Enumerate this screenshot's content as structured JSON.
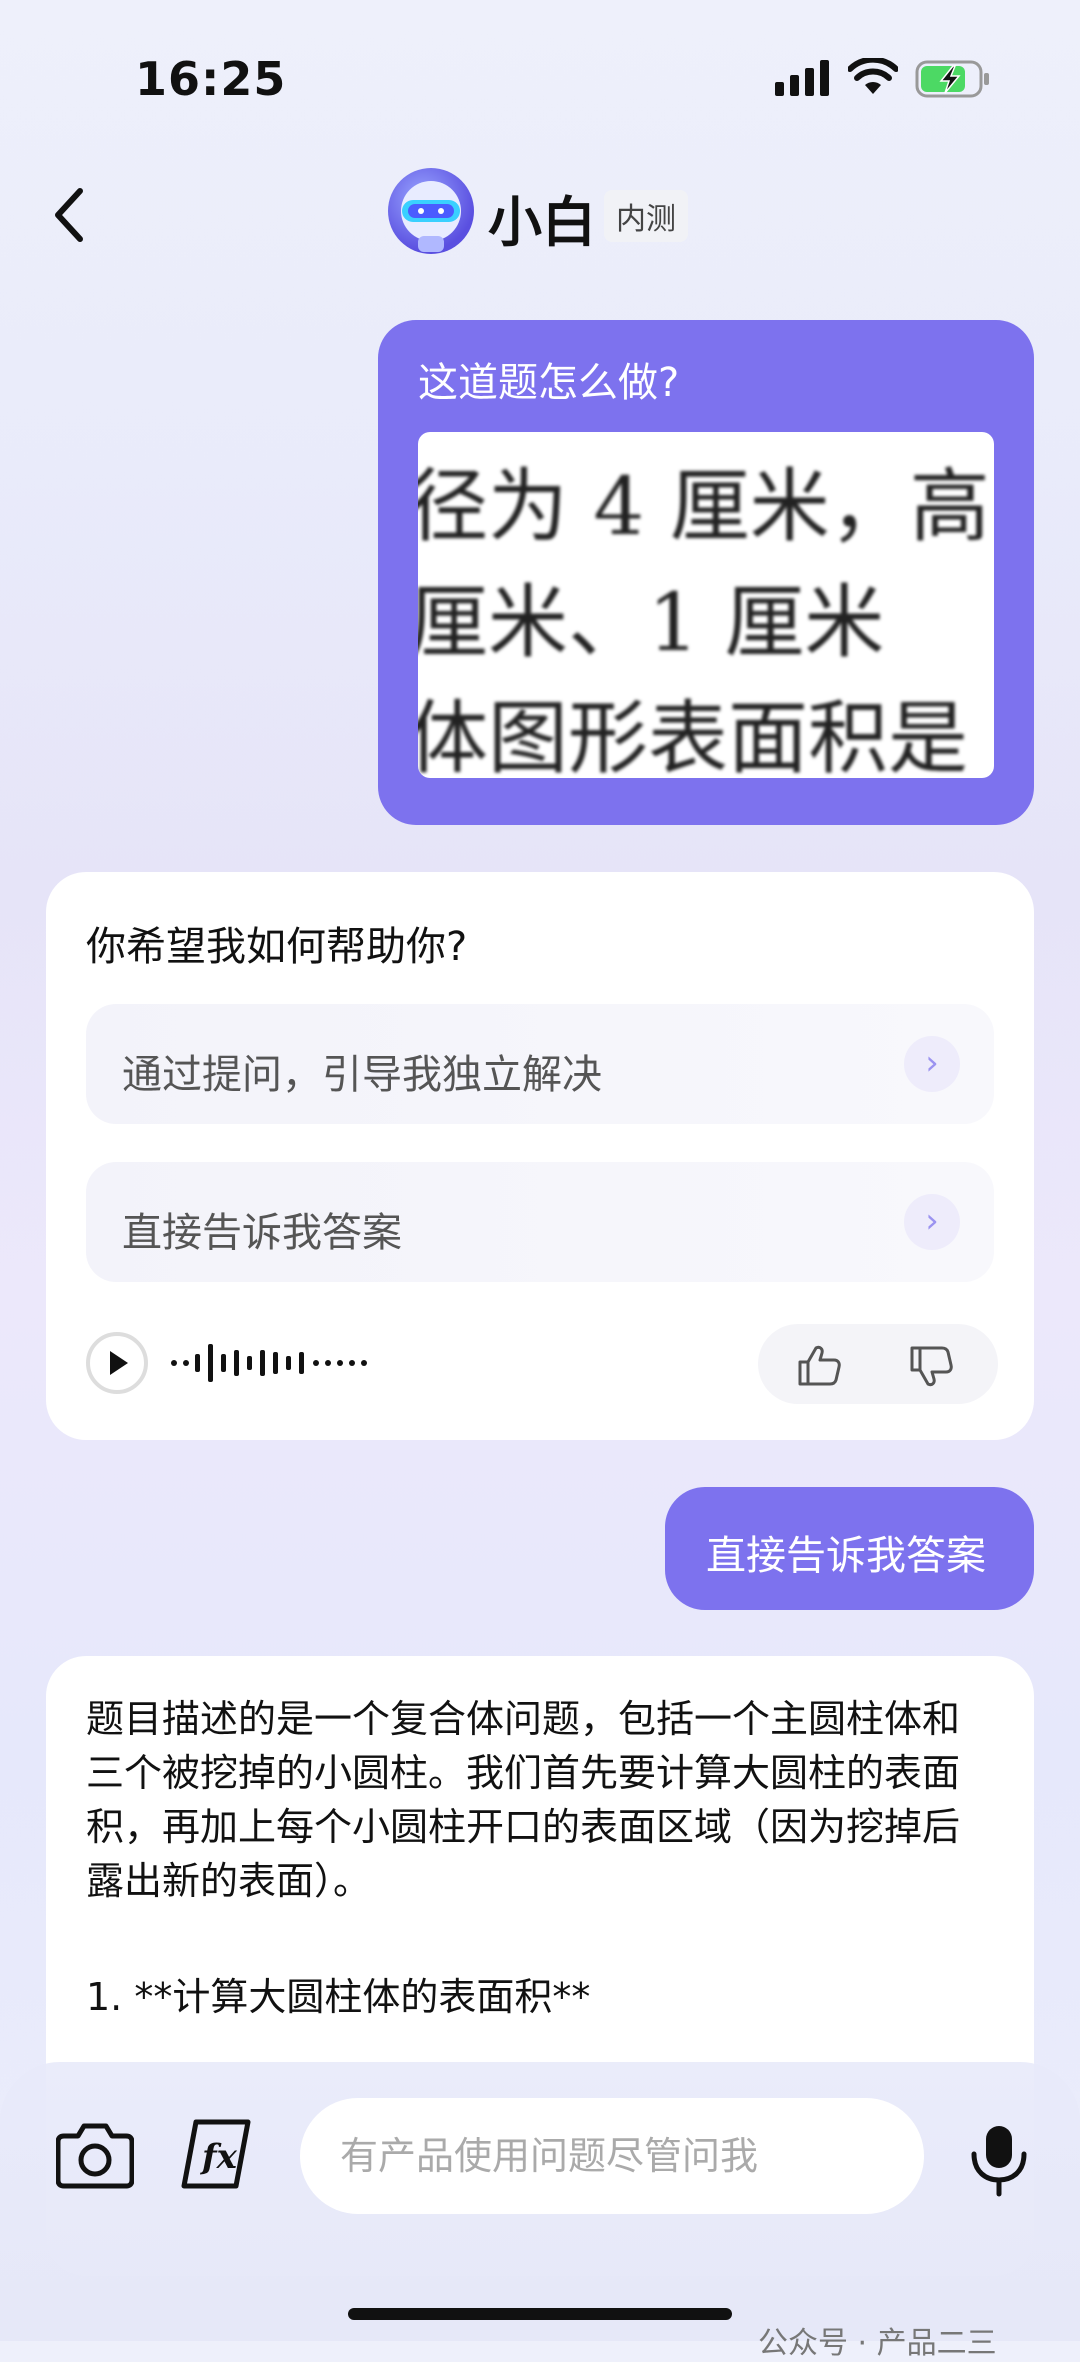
{
  "status_bar": {
    "time": "16:25",
    "battery_charging": true
  },
  "header": {
    "bot_name": "小白",
    "badge": "内测"
  },
  "conversation": {
    "user_question": "这道题怎么做?",
    "question_image_lines": [
      "径为 4 厘米，高",
      "厘米、1 厘米",
      "体图形表面积是"
    ],
    "assistant_prompt": "你希望我如何帮助你?",
    "options": [
      {
        "label": "通过提问，引导我独立解决"
      },
      {
        "label": "直接告诉我答案"
      }
    ],
    "user_reply": "直接告诉我答案",
    "answer_body": "题目描述的是一个复合体问题，包括一个主圆柱体和三个被挖掉的小圆柱。我们首先要计算大圆柱的表面积，再加上每个小圆柱开口的表面区域（因为挖掉后露出新的表面）。",
    "answer_step": "1. **计算大圆柱体的表面积**"
  },
  "input_bar": {
    "placeholder": "有产品使用问题尽管问我"
  },
  "watermark": "公众号 · 产品二三",
  "colors": {
    "accent": "#7d72ee",
    "card": "#ffffff"
  },
  "icons": [
    "back-icon",
    "camera-icon",
    "formula-icon",
    "mic-icon",
    "play-icon",
    "thumbs-up-icon",
    "thumbs-down-icon",
    "chevron-right-icon"
  ]
}
